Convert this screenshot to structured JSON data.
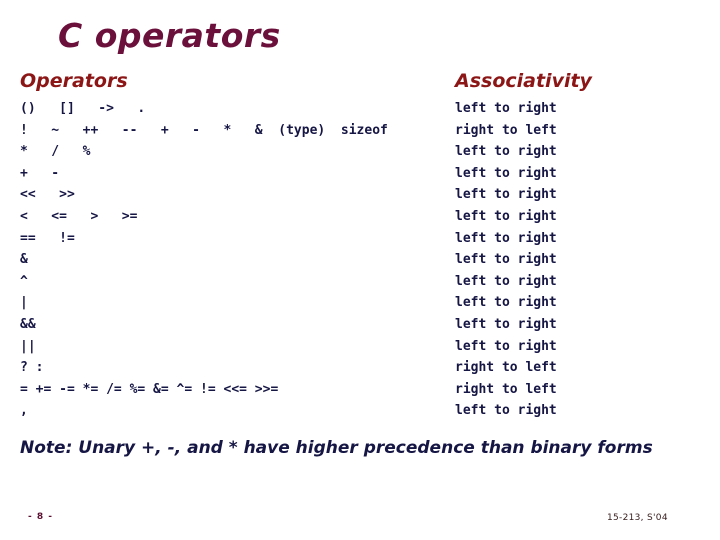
{
  "slide": {
    "title": "C operators",
    "note": "Note: Unary +, -, and * have higher precedence than binary forms",
    "footer_left": "- 8 -",
    "footer_right": "15-213, S'04",
    "colors": {
      "title": "#6B0F3B",
      "header": "#8C1616",
      "body": "#161645",
      "background": "#ffffff",
      "footer_left": "#5A1030",
      "footer_right": "#3A2020"
    }
  },
  "table": {
    "headers": {
      "operators": "Operators",
      "associativity": "Associativity"
    },
    "rows": [
      {
        "operators": "()   []   ->   .",
        "associativity": "left to right"
      },
      {
        "operators": "!   ~   ++   --   +   -   *   &  (type)  sizeof",
        "associativity": "right to left"
      },
      {
        "operators": "*   /   %",
        "associativity": "left to right"
      },
      {
        "operators": "+   -",
        "associativity": "left to right"
      },
      {
        "operators": "<<   >>",
        "associativity": "left to right"
      },
      {
        "operators": "<   <=   >   >=",
        "associativity": "left to right"
      },
      {
        "operators": "==   !=",
        "associativity": "left to right"
      },
      {
        "operators": "&",
        "associativity": "left to right"
      },
      {
        "operators": "^",
        "associativity": "left to right"
      },
      {
        "operators": "|",
        "associativity": "left to right"
      },
      {
        "operators": "&&",
        "associativity": "left to right"
      },
      {
        "operators": "||",
        "associativity": "left to right"
      },
      {
        "operators": "? :",
        "associativity": "right to left"
      },
      {
        "operators": "= += -= *= /= %= &= ^= != <<= >>=",
        "associativity": "right to left"
      },
      {
        "operators": ",",
        "associativity": "left to right"
      }
    ]
  }
}
